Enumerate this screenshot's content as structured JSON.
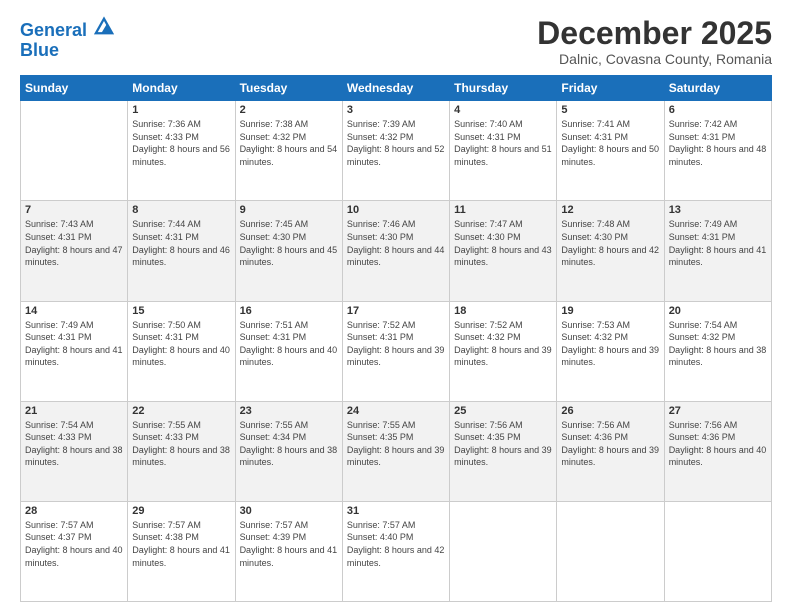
{
  "logo": {
    "line1": "General",
    "line2": "Blue"
  },
  "title": "December 2025",
  "subtitle": "Dalnic, Covasna County, Romania",
  "weekdays": [
    "Sunday",
    "Monday",
    "Tuesday",
    "Wednesday",
    "Thursday",
    "Friday",
    "Saturday"
  ],
  "weeks": [
    [
      {
        "day": "",
        "sunrise": "",
        "sunset": "",
        "daylight": ""
      },
      {
        "day": "1",
        "sunrise": "Sunrise: 7:36 AM",
        "sunset": "Sunset: 4:33 PM",
        "daylight": "Daylight: 8 hours and 56 minutes."
      },
      {
        "day": "2",
        "sunrise": "Sunrise: 7:38 AM",
        "sunset": "Sunset: 4:32 PM",
        "daylight": "Daylight: 8 hours and 54 minutes."
      },
      {
        "day": "3",
        "sunrise": "Sunrise: 7:39 AM",
        "sunset": "Sunset: 4:32 PM",
        "daylight": "Daylight: 8 hours and 52 minutes."
      },
      {
        "day": "4",
        "sunrise": "Sunrise: 7:40 AM",
        "sunset": "Sunset: 4:31 PM",
        "daylight": "Daylight: 8 hours and 51 minutes."
      },
      {
        "day": "5",
        "sunrise": "Sunrise: 7:41 AM",
        "sunset": "Sunset: 4:31 PM",
        "daylight": "Daylight: 8 hours and 50 minutes."
      },
      {
        "day": "6",
        "sunrise": "Sunrise: 7:42 AM",
        "sunset": "Sunset: 4:31 PM",
        "daylight": "Daylight: 8 hours and 48 minutes."
      }
    ],
    [
      {
        "day": "7",
        "sunrise": "Sunrise: 7:43 AM",
        "sunset": "Sunset: 4:31 PM",
        "daylight": "Daylight: 8 hours and 47 minutes."
      },
      {
        "day": "8",
        "sunrise": "Sunrise: 7:44 AM",
        "sunset": "Sunset: 4:31 PM",
        "daylight": "Daylight: 8 hours and 46 minutes."
      },
      {
        "day": "9",
        "sunrise": "Sunrise: 7:45 AM",
        "sunset": "Sunset: 4:30 PM",
        "daylight": "Daylight: 8 hours and 45 minutes."
      },
      {
        "day": "10",
        "sunrise": "Sunrise: 7:46 AM",
        "sunset": "Sunset: 4:30 PM",
        "daylight": "Daylight: 8 hours and 44 minutes."
      },
      {
        "day": "11",
        "sunrise": "Sunrise: 7:47 AM",
        "sunset": "Sunset: 4:30 PM",
        "daylight": "Daylight: 8 hours and 43 minutes."
      },
      {
        "day": "12",
        "sunrise": "Sunrise: 7:48 AM",
        "sunset": "Sunset: 4:30 PM",
        "daylight": "Daylight: 8 hours and 42 minutes."
      },
      {
        "day": "13",
        "sunrise": "Sunrise: 7:49 AM",
        "sunset": "Sunset: 4:31 PM",
        "daylight": "Daylight: 8 hours and 41 minutes."
      }
    ],
    [
      {
        "day": "14",
        "sunrise": "Sunrise: 7:49 AM",
        "sunset": "Sunset: 4:31 PM",
        "daylight": "Daylight: 8 hours and 41 minutes."
      },
      {
        "day": "15",
        "sunrise": "Sunrise: 7:50 AM",
        "sunset": "Sunset: 4:31 PM",
        "daylight": "Daylight: 8 hours and 40 minutes."
      },
      {
        "day": "16",
        "sunrise": "Sunrise: 7:51 AM",
        "sunset": "Sunset: 4:31 PM",
        "daylight": "Daylight: 8 hours and 40 minutes."
      },
      {
        "day": "17",
        "sunrise": "Sunrise: 7:52 AM",
        "sunset": "Sunset: 4:31 PM",
        "daylight": "Daylight: 8 hours and 39 minutes."
      },
      {
        "day": "18",
        "sunrise": "Sunrise: 7:52 AM",
        "sunset": "Sunset: 4:32 PM",
        "daylight": "Daylight: 8 hours and 39 minutes."
      },
      {
        "day": "19",
        "sunrise": "Sunrise: 7:53 AM",
        "sunset": "Sunset: 4:32 PM",
        "daylight": "Daylight: 8 hours and 39 minutes."
      },
      {
        "day": "20",
        "sunrise": "Sunrise: 7:54 AM",
        "sunset": "Sunset: 4:32 PM",
        "daylight": "Daylight: 8 hours and 38 minutes."
      }
    ],
    [
      {
        "day": "21",
        "sunrise": "Sunrise: 7:54 AM",
        "sunset": "Sunset: 4:33 PM",
        "daylight": "Daylight: 8 hours and 38 minutes."
      },
      {
        "day": "22",
        "sunrise": "Sunrise: 7:55 AM",
        "sunset": "Sunset: 4:33 PM",
        "daylight": "Daylight: 8 hours and 38 minutes."
      },
      {
        "day": "23",
        "sunrise": "Sunrise: 7:55 AM",
        "sunset": "Sunset: 4:34 PM",
        "daylight": "Daylight: 8 hours and 38 minutes."
      },
      {
        "day": "24",
        "sunrise": "Sunrise: 7:55 AM",
        "sunset": "Sunset: 4:35 PM",
        "daylight": "Daylight: 8 hours and 39 minutes."
      },
      {
        "day": "25",
        "sunrise": "Sunrise: 7:56 AM",
        "sunset": "Sunset: 4:35 PM",
        "daylight": "Daylight: 8 hours and 39 minutes."
      },
      {
        "day": "26",
        "sunrise": "Sunrise: 7:56 AM",
        "sunset": "Sunset: 4:36 PM",
        "daylight": "Daylight: 8 hours and 39 minutes."
      },
      {
        "day": "27",
        "sunrise": "Sunrise: 7:56 AM",
        "sunset": "Sunset: 4:36 PM",
        "daylight": "Daylight: 8 hours and 40 minutes."
      }
    ],
    [
      {
        "day": "28",
        "sunrise": "Sunrise: 7:57 AM",
        "sunset": "Sunset: 4:37 PM",
        "daylight": "Daylight: 8 hours and 40 minutes."
      },
      {
        "day": "29",
        "sunrise": "Sunrise: 7:57 AM",
        "sunset": "Sunset: 4:38 PM",
        "daylight": "Daylight: 8 hours and 41 minutes."
      },
      {
        "day": "30",
        "sunrise": "Sunrise: 7:57 AM",
        "sunset": "Sunset: 4:39 PM",
        "daylight": "Daylight: 8 hours and 41 minutes."
      },
      {
        "day": "31",
        "sunrise": "Sunrise: 7:57 AM",
        "sunset": "Sunset: 4:40 PM",
        "daylight": "Daylight: 8 hours and 42 minutes."
      },
      {
        "day": "",
        "sunrise": "",
        "sunset": "",
        "daylight": ""
      },
      {
        "day": "",
        "sunrise": "",
        "sunset": "",
        "daylight": ""
      },
      {
        "day": "",
        "sunrise": "",
        "sunset": "",
        "daylight": ""
      }
    ]
  ]
}
